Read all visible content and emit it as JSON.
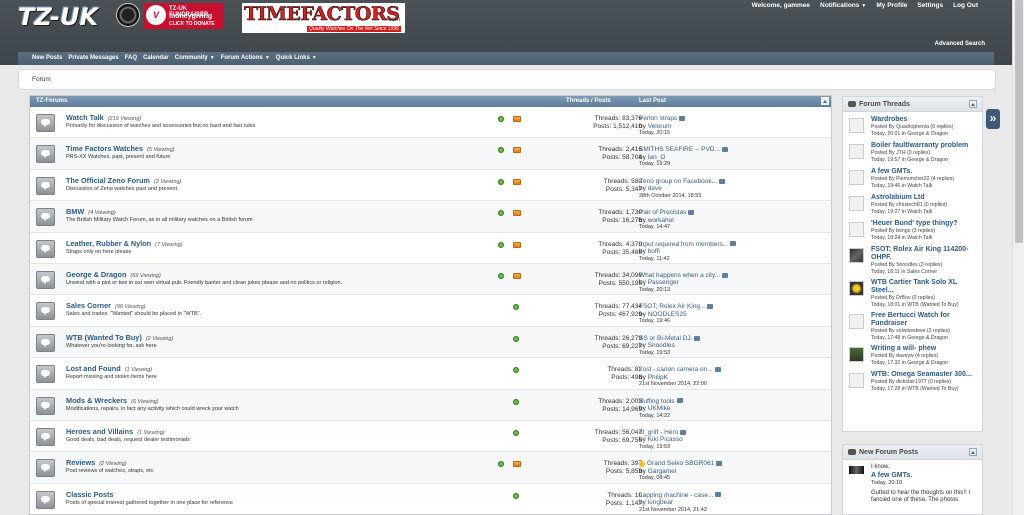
{
  "header": {
    "logo_text": "TZ-UK",
    "virgin": {
      "logo": "V",
      "line1": "TZ-UK FUNDRAISER",
      "line2": "moneygiving",
      "line3": "CLICK TO DONATE"
    },
    "timefactors": {
      "logo": "TIMEFACTORS",
      "suffix": ".com",
      "tagline": "Quality Watches On The Net Since 1996"
    },
    "welcome": "Welcome,",
    "username": "gammee",
    "notifications": "Notifications",
    "my_profile": "My Profile",
    "settings": "Settings",
    "logout": "Log Out",
    "advanced_search": "Advanced Search"
  },
  "navbar": {
    "items": [
      "New Posts",
      "Private Messages",
      "FAQ",
      "Calendar",
      "Community",
      "Forum Actions",
      "Quick Links"
    ]
  },
  "breadcrumb": "Forum",
  "forum_table": {
    "title": "TZ-Forums",
    "col_stats": "Threads / Posts",
    "col_last": "Last Post",
    "forums": [
      {
        "name": "Watch Talk",
        "viewing": "(219 Viewing)",
        "desc": "Primarily for discussion of watches and accessories but no hard and fast rules",
        "threads": "Threads: 83,376",
        "posts": "Posts: 1,512,410",
        "last_title": "Perlon straps",
        "last_by": "Velorum",
        "last_date": "Today, 20:15"
      },
      {
        "name": "Time Factors Watches",
        "viewing": "(5 Viewing)",
        "desc": "PRS-XX Watches, past, present and future",
        "threads": "Threads: 2,416",
        "posts": "Posts: 58,704",
        "last_title": "SMITHS SEAFIRE -- PVD...",
        "last_by": "Ian_O",
        "last_date": "Today, 19:29"
      },
      {
        "name": "The Official Zeno Forum",
        "viewing": "(2 Viewing)",
        "desc": "Discussion of Zeno watches past and present",
        "threads": "Threads: 580",
        "posts": "Posts: 5,347",
        "last_title": "Zeno group on Facebook...",
        "last_by": "dave",
        "last_date": "28th October 2014, 18:55"
      },
      {
        "name": "BMW",
        "viewing": "(4 Viewing)",
        "desc": "The British Military Watch Forum, as in all military watches on a British forum",
        "threads": "Threads: 1,730",
        "posts": "Posts: 16,278",
        "last_title": "Pair of Precistas",
        "last_by": "workahol",
        "last_date": "Today, 14:47"
      },
      {
        "name": "Leather, Rubber & Nylon",
        "viewing": "(7 Viewing)",
        "desc": "Straps only on here please",
        "threads": "Threads: 4,370",
        "posts": "Posts: 35,488",
        "last_title": "Input required from members...",
        "last_by": "boffi",
        "last_date": "Today, 11:42"
      },
      {
        "name": "George & Dragon",
        "viewing": "(69 Viewing)",
        "desc": "Unwind with a pint or two in our own virtual pub. Friendly banter and clean jokes please and no politics or religion.",
        "threads": "Threads: 34,096",
        "posts": "Posts: 550,195",
        "last_title": "What happens when a city...",
        "last_by": "Passenger",
        "last_date": "Today, 20:13"
      },
      {
        "name": "Sales Corner",
        "viewing": "(90 Viewing)",
        "desc": "Sales and trades. \"Wanted\" should be placed in \"WTB\".",
        "threads": "Threads: 77,434",
        "posts": "Posts: 467,929",
        "last_title": "FSOT; Rolex Air King...",
        "last_by": "NOODLES25",
        "last_date": "Today, 19:46"
      },
      {
        "name": "WTB (Wanted To Buy)",
        "viewing": "(2 Viewing)",
        "desc": "Whatever you're looking for, ask here",
        "threads": "Threads: 26,279",
        "posts": "Posts: 69,227",
        "last_title": "SS or Bi-Metal DJ.",
        "last_by": "Snoodles",
        "last_date": "Today, 19:53"
      },
      {
        "name": "Lost and Found",
        "viewing": "(1 Viewing)",
        "desc": "Report missing and stolen items here",
        "threads": "Threads: 82",
        "posts": "Posts: 498",
        "last_title": "Lost - canon camera on...",
        "last_by": "PhilipK",
        "last_date": "21st November 2014, 22:00"
      },
      {
        "name": "Mods & Wreckers",
        "viewing": "(6 Viewing)",
        "desc": "Modifications, repairs, in fact any activity which could wreck your watch",
        "threads": "Threads: 2,003",
        "posts": "Posts: 14,969",
        "last_title": "Buffing tools",
        "last_by": "UKMike",
        "last_date": "Today, 14:22"
      },
      {
        "name": "Heroes and Villains",
        "viewing": "(1 Viewing)",
        "desc": "Good deals, bad deals, request dealer testimonials",
        "threads": "Threads: 56,047",
        "posts": "Posts: 69,755",
        "last_title": "dl_griff - Hero",
        "last_by": "Kiki Picasso",
        "last_date": "Today, 19:53"
      },
      {
        "name": "Reviews",
        "viewing": "(2 Viewing)",
        "desc": "Post reviews of watches, straps, etc",
        "threads": "Threads: 397",
        "posts": "Posts: 5,859",
        "last_title": "Grand Seiko SBGR061",
        "last_by": "Gargamel",
        "last_date": "Today, 08:45"
      },
      {
        "name": "Classic Posts",
        "viewing": "",
        "desc": "Posts of special interest gathered together in one place for reference",
        "threads": "Threads: 10",
        "posts": "Posts: 1,147",
        "last_title": "Lapping machine - case...",
        "last_by": "longbear",
        "last_date": "21st November 2014, 21:42"
      }
    ]
  },
  "by_label": "by",
  "sidebar": {
    "threads_title": "Forum Threads",
    "threads": [
      {
        "title": "Wardrobes",
        "meta1": "Posted By Quadrophenia (0 replies)",
        "meta2": "Today, 20:01 in George & Dragon"
      },
      {
        "title": "Boiler fault/warranty problem",
        "meta1": "Posted By JTH (0 replies)",
        "meta2": "Today, 19:57 in George & Dragon"
      },
      {
        "title": "A few GMTs.",
        "meta1": "Posted By Piemuncher22 (4 replies)",
        "meta2": "Today, 19:46 in Watch Talk"
      },
      {
        "title": "Astrolabium Ltd",
        "meta1": "Posted By christech81 (0 replies)",
        "meta2": "Today, 19:27 in Watch Talk"
      },
      {
        "title": "'Heuer Bund' type thingy?",
        "meta1": "Posted By bongo (3 replies)",
        "meta2": "Today, 18:24 in Watch Talk"
      },
      {
        "title": "FSOT; Rolex Air King 114200-OHPF.",
        "meta1": "Posted By Snoodles (3 replies)",
        "meta2": "Today, 18:11 in Sales Corner"
      },
      {
        "title": "WTB Cartier Tank Solo XL Steel...",
        "meta1": "Posted By DrBov (0 replies)",
        "meta2": "Today, 18:01 in WTB (Wanted To Buy)"
      },
      {
        "title": "Free Bertucci Watch for Fundraiser",
        "meta1": "Posted By solwisesteve (2 replies)",
        "meta2": "Today, 17:48 in George & Dragon"
      },
      {
        "title": "Writing a will- phew",
        "meta1": "Posted By daveyw (4 replies)",
        "meta2": "Today, 17:32 in George & Dragon"
      },
      {
        "title": "WTB: Omega Seamaster 300...",
        "meta1": "Posted By dicksfair1977 (0 replies)",
        "meta2": "Today, 17:28 in WTB (Wanted To Buy)"
      }
    ],
    "posts_title": "New Forum Posts",
    "posts": [
      {
        "text": "I know.",
        "title": "A few GMTs.",
        "meta": "Today, 20:10"
      },
      {
        "text": "Gutted to hear the thoughts on this!! I fancied one of these. The photos",
        "title": "",
        "meta": ""
      }
    ]
  }
}
